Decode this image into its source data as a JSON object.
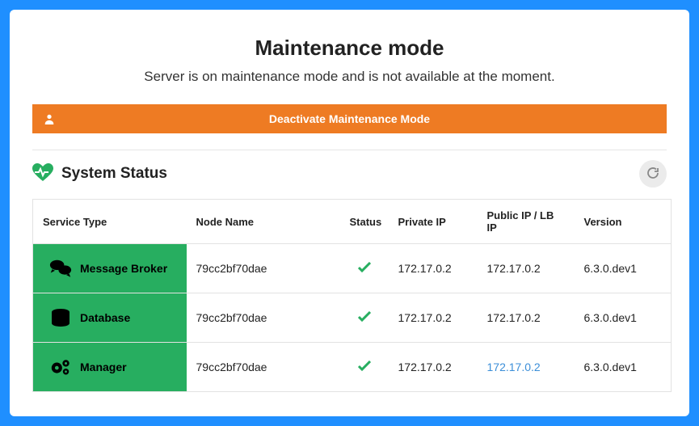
{
  "header": {
    "title": "Maintenance mode",
    "subtitle": "Server is on maintenance mode and is not available at the moment.",
    "deactivate_label": "Deactivate Maintenance Mode"
  },
  "status_section": {
    "title": "System Status",
    "columns": {
      "c0": "Service Type",
      "c1": "Node Name",
      "c2": "Status",
      "c3": "Private IP",
      "c4": "Public IP / LB IP",
      "c5": "Version"
    },
    "rows": [
      {
        "service": "Message Broker",
        "node": "79cc2bf70dae",
        "status": "ok",
        "private_ip": "172.17.0.2",
        "public_ip": "172.17.0.2",
        "public_is_link": false,
        "version": "6.3.0.dev1",
        "icon": "chat"
      },
      {
        "service": "Database",
        "node": "79cc2bf70dae",
        "status": "ok",
        "private_ip": "172.17.0.2",
        "public_ip": "172.17.0.2",
        "public_is_link": false,
        "version": "6.3.0.dev1",
        "icon": "database"
      },
      {
        "service": "Manager",
        "node": "79cc2bf70dae",
        "status": "ok",
        "private_ip": "172.17.0.2",
        "public_ip": "172.17.0.2",
        "public_is_link": true,
        "version": "6.3.0.dev1",
        "icon": "gears"
      }
    ]
  },
  "colors": {
    "accent_green": "#27ae60",
    "accent_orange": "#ee7b23",
    "frame_blue": "#1f8fff"
  }
}
